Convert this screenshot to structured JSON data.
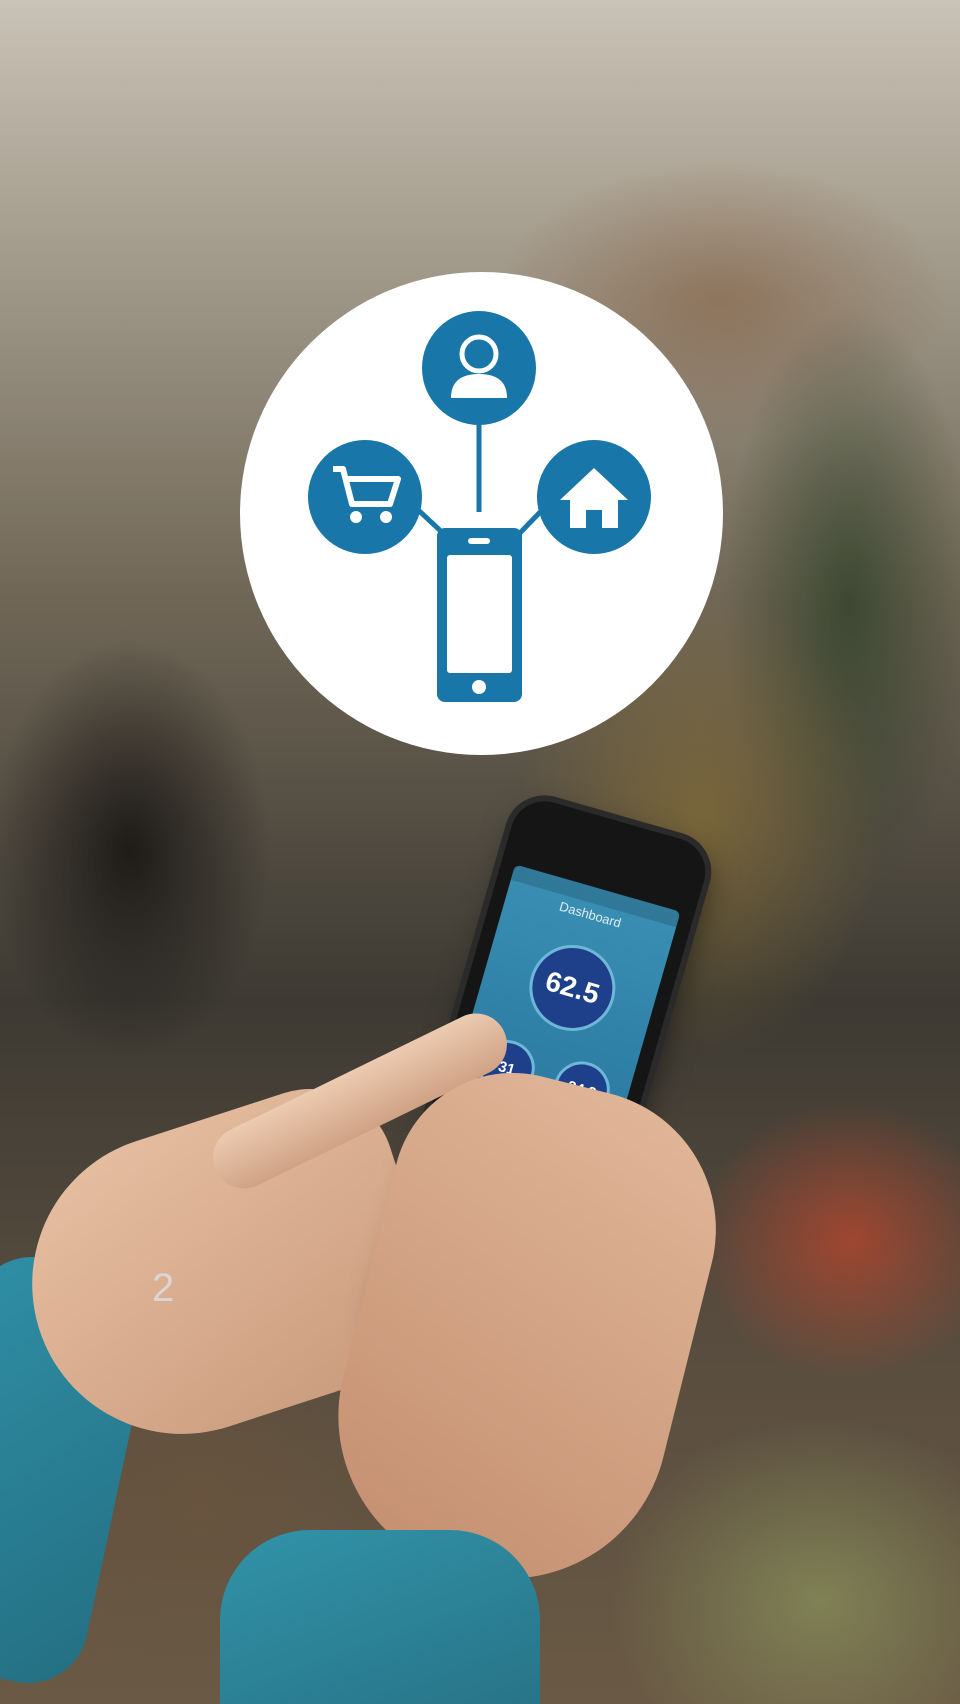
{
  "hero": {
    "icons": [
      "user-icon",
      "shopping-cart-icon",
      "home-icon",
      "smartphone-icon"
    ],
    "accent_color": "#1876a8"
  },
  "phone_app": {
    "title": "Dashboard",
    "main_value": "62.5",
    "secondary_value_a": "31",
    "secondary_value_b": "24.2"
  },
  "page_indicator": {
    "current": "2"
  }
}
